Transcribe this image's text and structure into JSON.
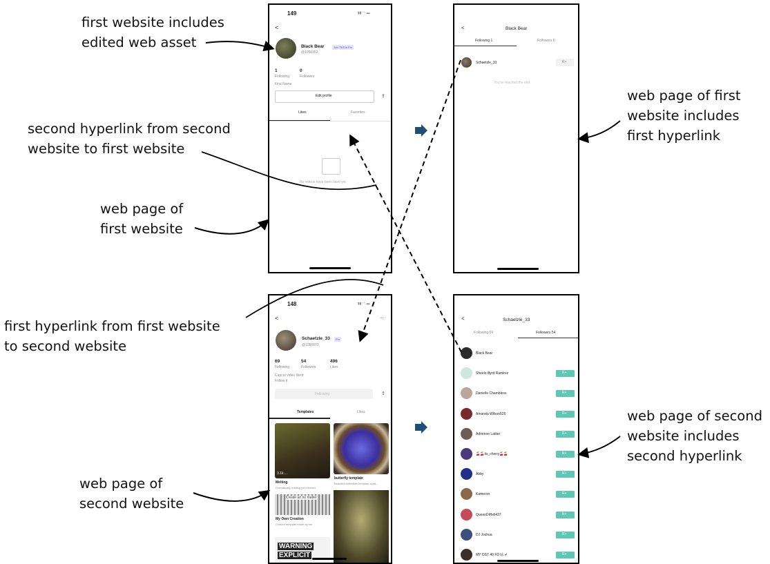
{
  "callouts": {
    "edited_asset": [
      "first website includes",
      "edited web asset"
    ],
    "second_hyperlink": [
      "second hyperlink from second",
      "website to first website"
    ],
    "page_first": [
      "web page of",
      "first website"
    ],
    "first_hyperlink": [
      "first hyperlink from first website",
      "to second website"
    ],
    "page_second": [
      "web page of",
      "second website"
    ],
    "page_first_link": [
      "web page of first",
      "website includes",
      "first hyperlink"
    ],
    "page_second_link": [
      "web page of second",
      "website includes",
      "second hyperlink"
    ]
  },
  "phone1": {
    "time": "149",
    "back": "<",
    "name": "Black Bear",
    "badge": "Join TikTok Pro",
    "handle": "@1050352",
    "stat1_num": "1",
    "stat1_label": "Following",
    "stat2_num": "0",
    "stat2_label": "Followers",
    "bio": "First Name",
    "edit": "Edit profile",
    "tab_likes": "Likes",
    "tab_fav": "Favorites",
    "empty": "No videos have been liked yet"
  },
  "phone2": {
    "back": "<",
    "title": "Black Bear",
    "tab_following": "Following 1",
    "tab_followers": "Followers 0",
    "user": "Schaetzle_33",
    "end": "You've reached the end"
  },
  "phone3": {
    "time": "148",
    "back": "<",
    "more": "...",
    "name": "Schaetzle_33",
    "badge": "Pro",
    "handle": "@1050073",
    "stat1_num": "69",
    "stat1_label": "Following",
    "stat2_num": "54",
    "stat2_label": "Followers",
    "stat3_num": "496",
    "stat3_label": "Likes",
    "bio": "Capcut video Nerd",
    "link": "Follow it",
    "following_btn": "Following",
    "tab_templates": "Templates",
    "tab_likes": "Likes",
    "card1_title": "Melting",
    "card1_sub": "Dramatically melting your frames",
    "card2_title": "butterfly template",
    "card2_sub": "Beautiful butterflies template spirit...",
    "card3_top": "Create art no matter",
    "card3_title": "My Own Creation",
    "card3_sub": "Custom template made by me",
    "card5_text1": "WARNING",
    "card5_text2": "EXPLICIT",
    "card1_stats": "3.1k  ..."
  },
  "phone4": {
    "back": "<",
    "title": "Schaetzle_33",
    "tab_following": "Following 69",
    "tab_followers": "Followers 54",
    "users": [
      "Black Bear",
      "Sheelo Byrd Ramirez",
      "Danielle Chambless",
      "Amanda Wilson526",
      "Adrienne Lattier",
      "🍒🍒its_cherry🍒🍒",
      "Abby",
      "Kameron",
      "QueenDiHell437",
      "DJ Joshua",
      "MY OST 40 FD 🎼✔"
    ],
    "avatar_colors": [
      "#2b2b2b",
      "#cfe7df",
      "#b8a79a",
      "#7a2a2a",
      "#6b5e57",
      "#4b3a7a",
      "#1f2f8a",
      "#8a6a4a",
      "#c44b5a",
      "#3d4f7a",
      "#3a3029"
    ]
  },
  "arrow_color": "#1f4e79"
}
